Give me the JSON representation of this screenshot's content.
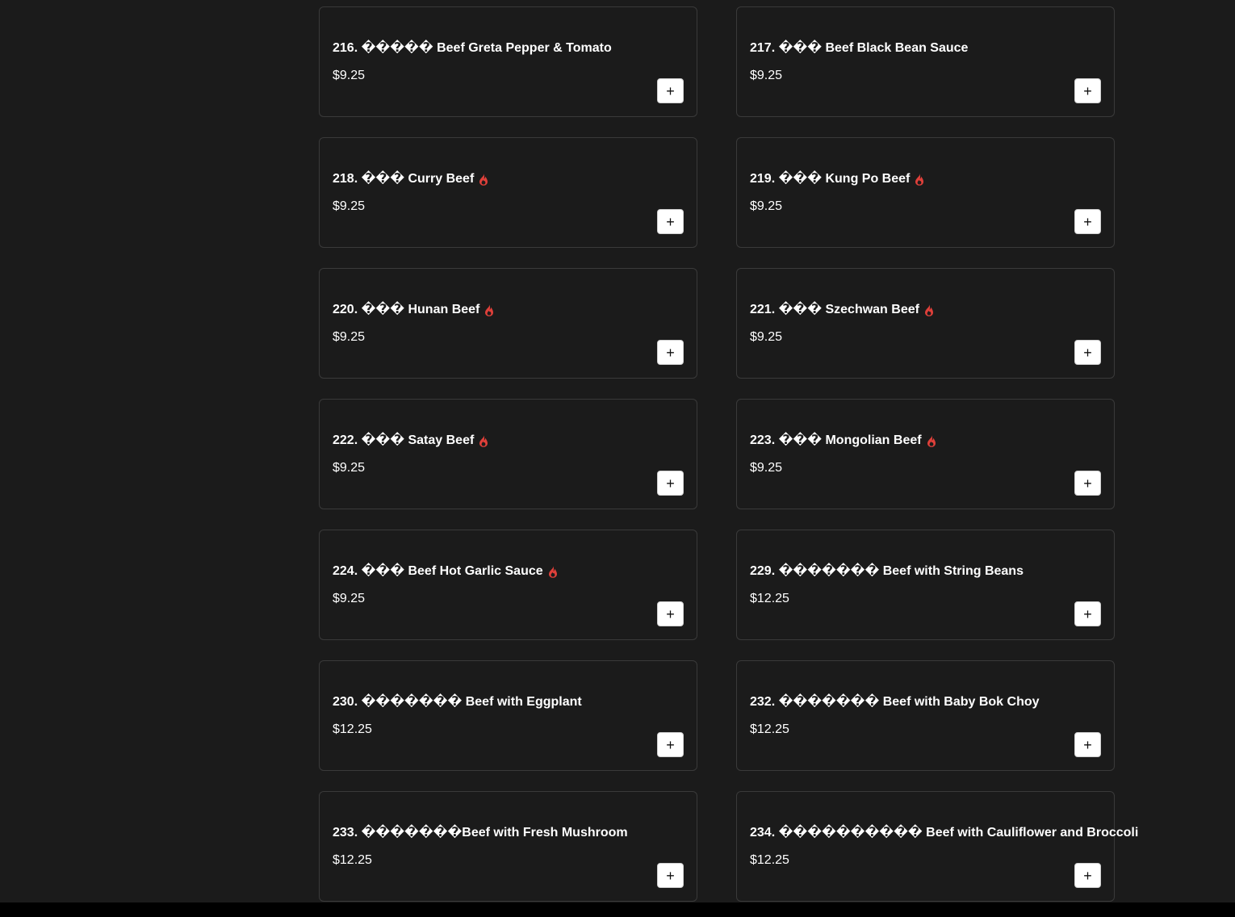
{
  "colors": {
    "background": "#1b1b1b",
    "card_border": "#3a3a3a",
    "spicy_icon": "#e0403a",
    "add_button_bg": "#ffffff",
    "bottom_bar": "#000000"
  },
  "add_button_label": "+",
  "menu_items": [
    {
      "title": "216. ����� Beef Greta Pepper & Tomato",
      "price": "$9.25",
      "spicy": false
    },
    {
      "title": "217. ��� Beef Black Bean Sauce",
      "price": "$9.25",
      "spicy": false
    },
    {
      "title": "218. ��� Curry Beef",
      "price": "$9.25",
      "spicy": true
    },
    {
      "title": "219. ��� Kung Po Beef",
      "price": "$9.25",
      "spicy": true
    },
    {
      "title": "220. ��� Hunan Beef",
      "price": "$9.25",
      "spicy": true
    },
    {
      "title": "221. ��� Szechwan Beef",
      "price": "$9.25",
      "spicy": true
    },
    {
      "title": "222. ��� Satay Beef",
      "price": "$9.25",
      "spicy": true
    },
    {
      "title": "223. ��� Mongolian Beef",
      "price": "$9.25",
      "spicy": true
    },
    {
      "title": "224. ��� Beef Hot Garlic Sauce",
      "price": "$9.25",
      "spicy": true
    },
    {
      "title": "229. ������� Beef with String Beans",
      "price": "$12.25",
      "spicy": false
    },
    {
      "title": "230. ������� Beef with Eggplant",
      "price": "$12.25",
      "spicy": false
    },
    {
      "title": "232. ������� Beef with Baby Bok Choy",
      "price": "$12.25",
      "spicy": false
    },
    {
      "title": "233. �������Beef with Fresh Mushroom",
      "price": "$12.25",
      "spicy": false
    },
    {
      "title": "234. ���������� Beef with Cauliflower and Broccoli",
      "price": "$12.25",
      "spicy": false
    }
  ]
}
